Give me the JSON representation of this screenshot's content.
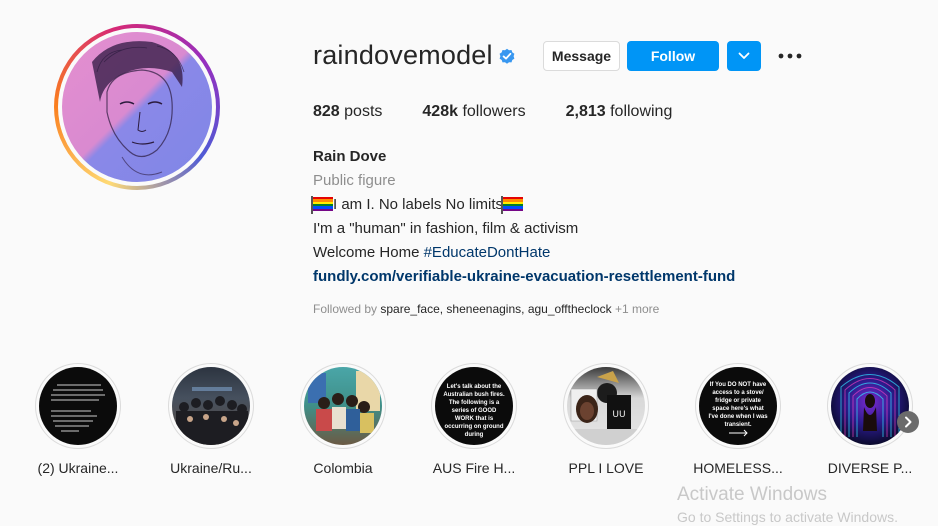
{
  "profile": {
    "username": "raindovemodel",
    "verified_icon": "verified-badge-icon",
    "message_label": "Message",
    "follow_label": "Follow",
    "more_icon": "more-options-icon",
    "stats": {
      "posts_count": "828",
      "posts_label": "posts",
      "followers_count": "428k",
      "followers_label": "followers",
      "following_count": "2,813",
      "following_label": "following"
    },
    "full_name": "Rain Dove",
    "category": "Public figure",
    "bio": {
      "line1": "I am I. No labels No limits",
      "line2": "I'm a \"human\" in fashion, film & activism",
      "line3_prefix": "Welcome Home ",
      "line3_hashtag": "#EducateDontHate",
      "link": "fundly.com/verifiable-ukraine-evacuation-resettlement-fund"
    },
    "followed_by": {
      "prefix": "Followed by ",
      "names": "spare_face, sheneenagins, agu_offtheclock",
      "more": " +1 more"
    }
  },
  "highlights": [
    {
      "label": "(2) Ukraine..."
    },
    {
      "label": "Ukraine/Ru..."
    },
    {
      "label": "Colombia"
    },
    {
      "label": "AUS Fire H...",
      "text": "Let's talk about the Australian bush fires. The following is a series of GOOD WORK that is occurring on ground during"
    },
    {
      "label": "PPL I LOVE"
    },
    {
      "label": "HOMELESS...",
      "text": "If You DO NOT have access to a stove/ fridge or private space here's what I've done when I was transient."
    },
    {
      "label": "DIVERSE P..."
    }
  ],
  "os_overlay": {
    "title": "Activate Windows",
    "subtitle": "Go to Settings to activate Windows."
  },
  "colors": {
    "accent": "#0095f6",
    "link": "#00376b",
    "muted": "#8e8e8e"
  }
}
